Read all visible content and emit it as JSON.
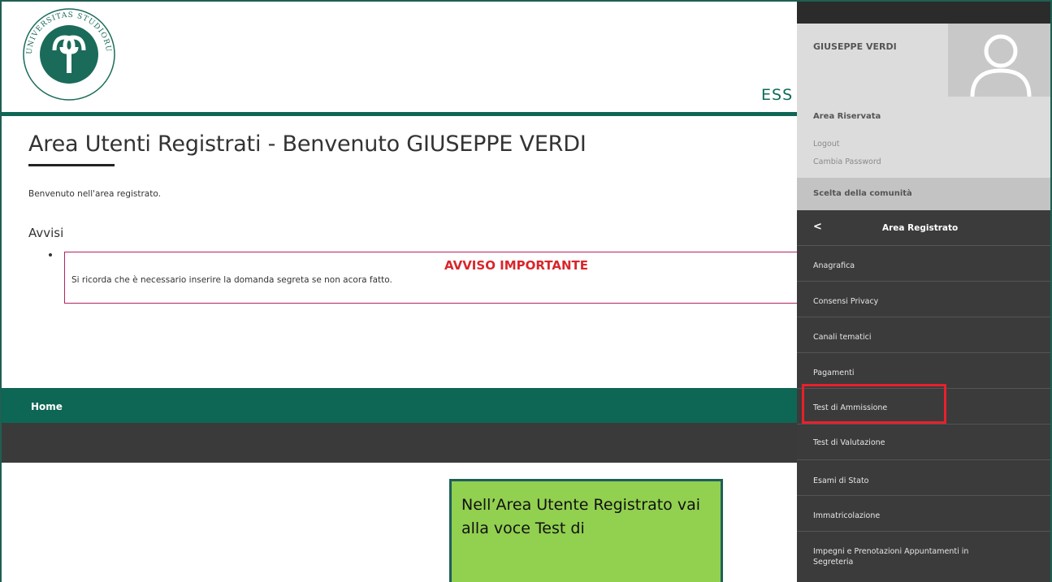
{
  "header": {
    "logo_alt": "UNIVERSITAS STUDIORUM INSUBRIAE",
    "ess_text": "ESS"
  },
  "main": {
    "title": "Area Utenti Registrati - Benvenuto GIUSEPPE VERDI",
    "welcome": "Benvenuto nell'area registrato.",
    "avvisi_heading": "Avvisi",
    "notice": {
      "title": "AVVISO IMPORTANTE",
      "text": "Si ricorda che è necessario inserire la domanda segreta se non acora fatto."
    }
  },
  "footer": {
    "home_label": "Home"
  },
  "callout": {
    "text": "Nell’Area Utente Registrato vai alla voce Test di"
  },
  "panel": {
    "user_name": "GIUSEPPE VERDI",
    "area_riservata": "Area Riservata",
    "logout": "Logout",
    "change_password": "Cambia Password",
    "community": "Scelta della comunità",
    "section_back": "<",
    "section_title": "Area Registrato",
    "menu": [
      "Anagrafica",
      "Consensi Privacy",
      "Canali tematici",
      "Pagamenti",
      "Test di Ammissione",
      "Test di Valutazione",
      "Esami di Stato",
      "Immatricolazione",
      "Impegni e Prenotazioni Appuntamenti in",
      "Segreteria"
    ]
  },
  "colors": {
    "brand_green": "#0e6655",
    "highlight_red": "#e8202b",
    "callout_green": "#92d050",
    "notice_red": "#d9262b"
  }
}
